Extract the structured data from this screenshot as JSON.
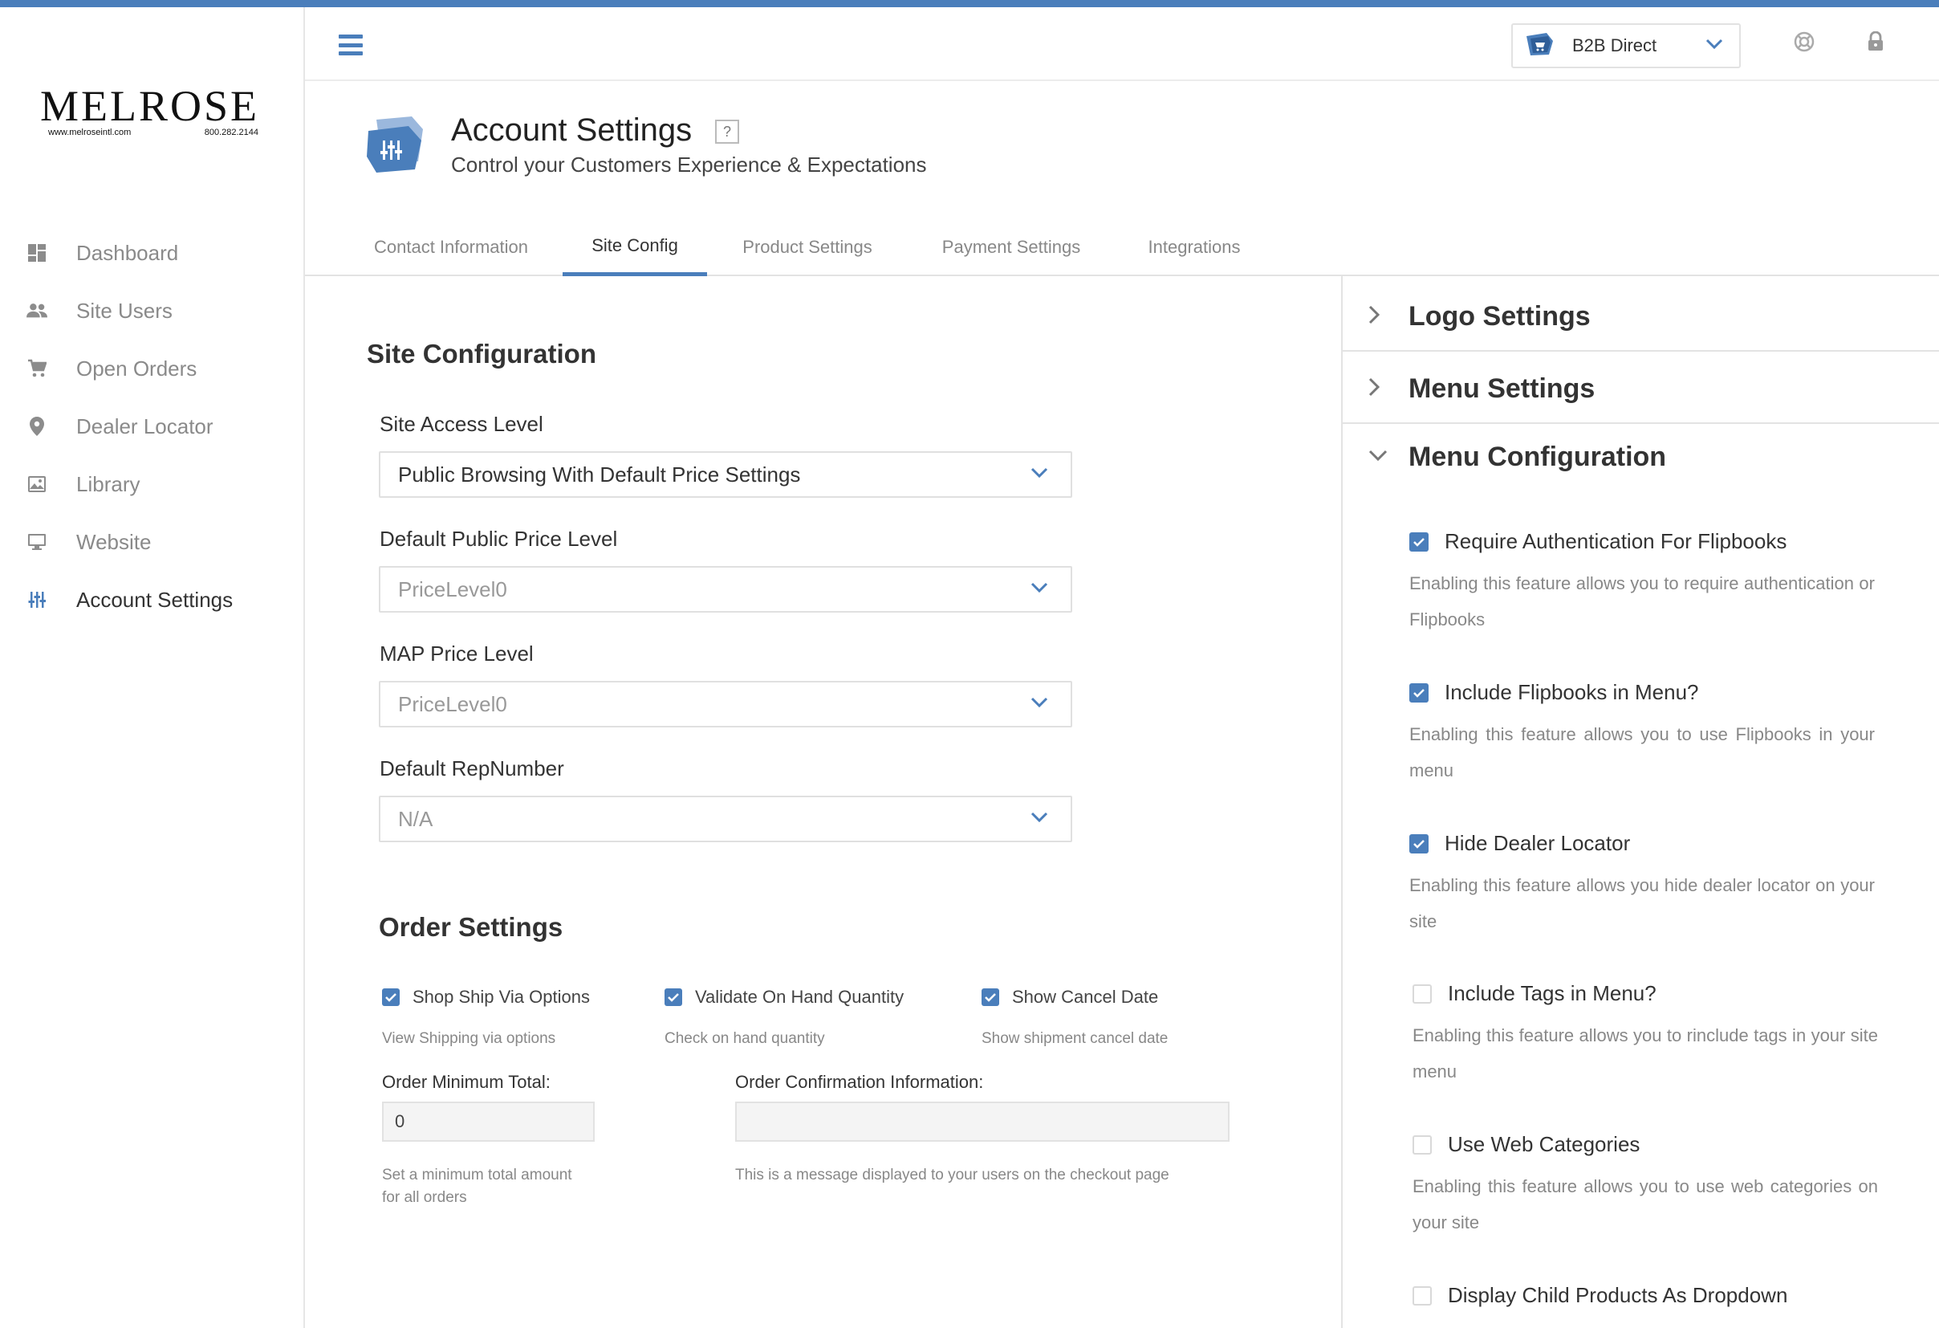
{
  "brand": {
    "name": "MELROSE",
    "website": "www.melroseintl.com",
    "phone": "800.282.2144",
    "accent_color": "#4a7ebb"
  },
  "sidebar": {
    "items": [
      {
        "label": "Dashboard",
        "icon": "dashboard-icon",
        "active": false
      },
      {
        "label": "Site Users",
        "icon": "users-icon",
        "active": false
      },
      {
        "label": "Open Orders",
        "icon": "cart-icon",
        "active": false
      },
      {
        "label": "Dealer Locator",
        "icon": "location-pin-icon",
        "active": false
      },
      {
        "label": "Library",
        "icon": "image-icon",
        "active": false
      },
      {
        "label": "Website",
        "icon": "monitor-icon",
        "active": false
      },
      {
        "label": "Account Settings",
        "icon": "sliders-icon",
        "active": true
      }
    ]
  },
  "header": {
    "store_selector": "B2B Direct"
  },
  "page": {
    "title": "Account Settings",
    "help": "?",
    "subtitle": "Control your Customers Experience & Expectations"
  },
  "tabs": [
    {
      "label": "Contact Information",
      "active": false
    },
    {
      "label": "Site Config",
      "active": true
    },
    {
      "label": "Product Settings",
      "active": false
    },
    {
      "label": "Payment Settings",
      "active": false
    },
    {
      "label": "Integrations",
      "active": false
    }
  ],
  "site_config": {
    "title": "Site Configuration",
    "fields": [
      {
        "label": "Site Access Level",
        "value": "Public Browsing With Default Price Settings"
      },
      {
        "label": "Default Public Price Level",
        "value": "PriceLevel0"
      },
      {
        "label": "MAP Price Level",
        "value": "PriceLevel0"
      },
      {
        "label": "Default RepNumber",
        "value": "N/A"
      }
    ]
  },
  "order_settings": {
    "title": "Order Settings",
    "checkboxes": [
      {
        "label": "Shop Ship Via Options",
        "desc": "View Shipping via options",
        "checked": true
      },
      {
        "label": "Validate On Hand Quantity",
        "desc": "Check on hand quantity",
        "checked": true
      },
      {
        "label": "Show Cancel Date",
        "desc": "Show shipment cancel date",
        "checked": true
      }
    ],
    "min_total": {
      "label": "Order Minimum Total:",
      "value": "0",
      "desc_line1": "Set a minimum total amount",
      "desc_line2": "for all orders"
    },
    "confirmation": {
      "label": "Order Confirmation Information:",
      "value": "",
      "desc": "This is a message displayed to your users on the checkout page"
    }
  },
  "right_panel": {
    "logo_settings": "Logo Settings",
    "menu_settings": "Menu Settings",
    "menu_configuration": "Menu Configuration",
    "options": [
      {
        "label": "Require Authentication For Flipbooks",
        "checked": true,
        "desc": "Enabling this feature allows you to require authentication or Flipbooks"
      },
      {
        "label": "Include Flipbooks in Menu?",
        "checked": true,
        "desc": "Enabling this feature allows you to use Flipbooks in your menu"
      },
      {
        "label": "Hide Dealer Locator",
        "checked": true,
        "desc": "Enabling this feature allows you hide dealer locator on your site"
      },
      {
        "label": "Include Tags in Menu?",
        "checked": false,
        "desc": "Enabling this feature allows you to rinclude tags in your site menu"
      },
      {
        "label": "Use Web Categories",
        "checked": false,
        "desc": "Enabling this feature allows you to use web categories on your site"
      },
      {
        "label": "Display Child Products As Dropdown",
        "checked": false,
        "desc": ""
      }
    ]
  }
}
